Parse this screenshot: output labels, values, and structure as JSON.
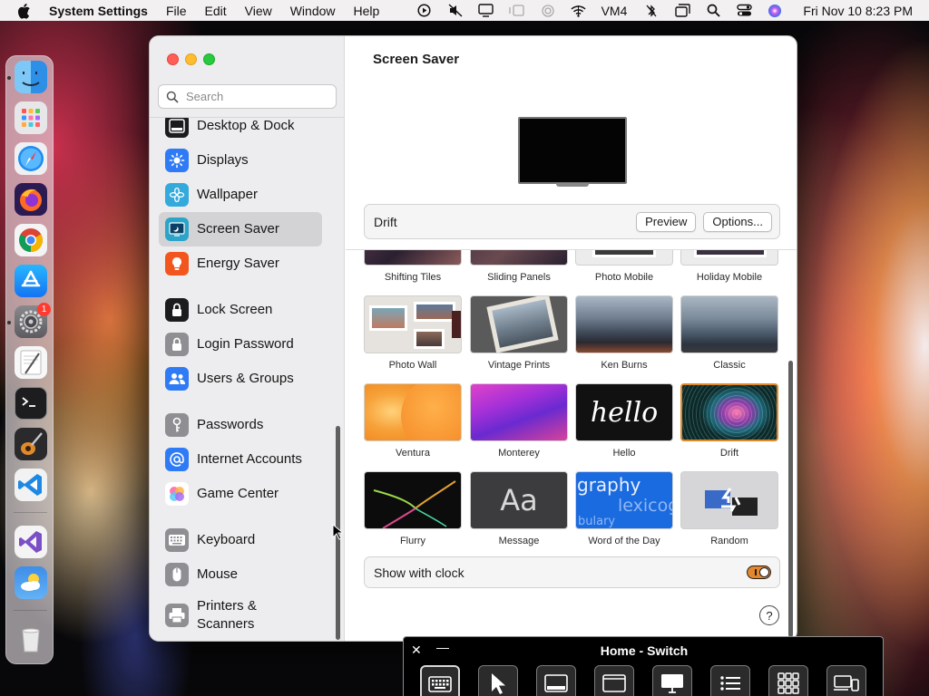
{
  "menubar": {
    "app_name": "System Settings",
    "menus": [
      "File",
      "Edit",
      "View",
      "Window",
      "Help"
    ],
    "vm_label": "VM4",
    "clock": "Fri Nov 10  8:23 PM"
  },
  "dock": {
    "apps": [
      "finder",
      "launchpad",
      "safari",
      "firefox",
      "chrome",
      "app-store",
      "system-settings",
      "textedit",
      "terminal",
      "garageband",
      "vscode",
      "visual-studio",
      "weather",
      "trash"
    ],
    "settings_badge": "1"
  },
  "window": {
    "search_placeholder": "Search",
    "sidebar": {
      "items": [
        {
          "label": "Desktop & Dock",
          "icon": "desktop-dock-icon",
          "color": "#1c1c1e"
        },
        {
          "label": "Displays",
          "icon": "displays-icon",
          "color": "#2f7bf5"
        },
        {
          "label": "Wallpaper",
          "icon": "wallpaper-icon",
          "color": "#34aadc"
        },
        {
          "label": "Screen Saver",
          "icon": "screen-saver-icon",
          "color": "#2aa5c9"
        },
        {
          "label": "Energy Saver",
          "icon": "energy-saver-icon",
          "color": "#f2561d"
        },
        {
          "label": "Lock Screen",
          "icon": "lock-screen-icon",
          "color": "#1c1c1e"
        },
        {
          "label": "Login Password",
          "icon": "login-password-icon",
          "color": "#8e8e93"
        },
        {
          "label": "Users & Groups",
          "icon": "users-groups-icon",
          "color": "#2f7bf5"
        },
        {
          "label": "Passwords",
          "icon": "passwords-icon",
          "color": "#8e8e93"
        },
        {
          "label": "Internet Accounts",
          "icon": "internet-accounts-icon",
          "color": "#2f7bf5"
        },
        {
          "label": "Game Center",
          "icon": "game-center-icon",
          "color": "#ffffff"
        },
        {
          "label": "Keyboard",
          "icon": "keyboard-icon",
          "color": "#8e8e93"
        },
        {
          "label": "Mouse",
          "icon": "mouse-icon",
          "color": "#8e8e93"
        },
        {
          "label": "Printers &",
          "label2": "Scanners",
          "icon": "printers-scanners-icon",
          "color": "#8e8e93"
        }
      ],
      "selected": "Screen Saver"
    },
    "main": {
      "title": "Screen Saver",
      "current_saver": "Drift",
      "preview_button": "Preview",
      "options_button": "Options...",
      "savers": [
        {
          "name": "Shifting Tiles"
        },
        {
          "name": "Sliding Panels"
        },
        {
          "name": "Photo Mobile"
        },
        {
          "name": "Holiday Mobile"
        },
        {
          "name": "Photo Wall"
        },
        {
          "name": "Vintage Prints"
        },
        {
          "name": "Ken Burns"
        },
        {
          "name": "Classic"
        },
        {
          "name": "Ventura"
        },
        {
          "name": "Monterey"
        },
        {
          "name": "Hello",
          "thumb_text": "hello"
        },
        {
          "name": "Drift",
          "selected": true
        },
        {
          "name": "Flurry"
        },
        {
          "name": "Message",
          "thumb_text": "Aa"
        },
        {
          "name": "Word of the Day",
          "thumb_text": [
            "graphy",
            "lexicog",
            "bulary"
          ]
        },
        {
          "name": "Random"
        }
      ],
      "show_with_clock_label": "Show with clock",
      "show_with_clock": true,
      "help_label": "?"
    }
  },
  "switch_panel": {
    "title": "Home - Switch",
    "close_label": "✕",
    "minimize_label": "—",
    "buttons": [
      "keyboard",
      "pointer",
      "window-bottom",
      "window",
      "display",
      "list",
      "grid",
      "devices"
    ]
  },
  "colors": {
    "accent_orange": "#e2872c",
    "selection_gray": "#d3d2d5"
  }
}
